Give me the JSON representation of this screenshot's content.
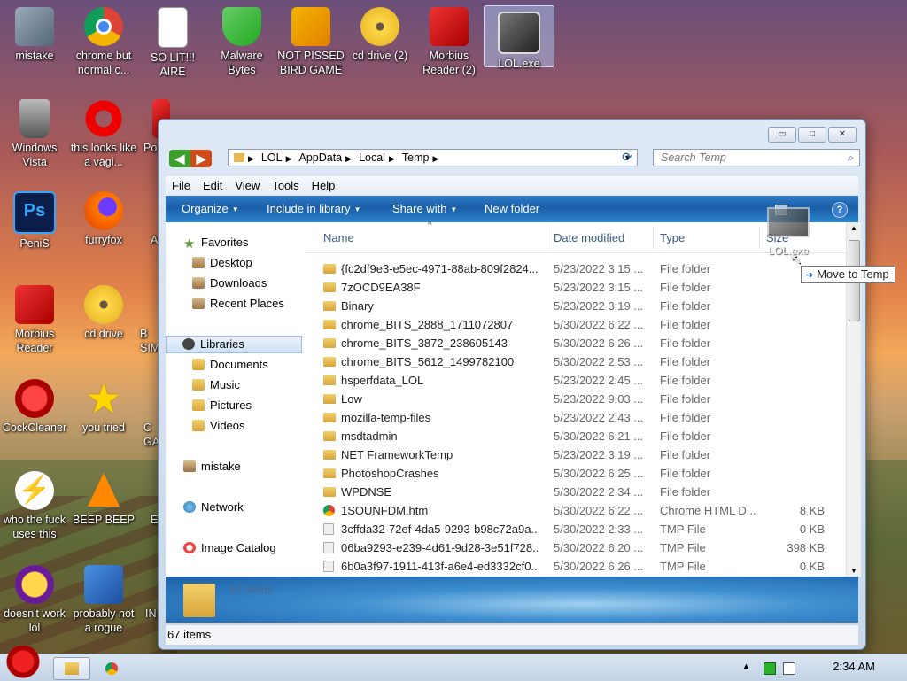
{
  "desktop": {
    "icons": [
      {
        "label": "mistake"
      },
      {
        "label": "chrome but normal c..."
      },
      {
        "label": "SO LIT!!! AIRE"
      },
      {
        "label": "Malware Bytes"
      },
      {
        "label": "NOT PISSED BIRD GAME"
      },
      {
        "label": "cd drive (2)"
      },
      {
        "label": "Morbius Reader (2)"
      },
      {
        "label": "LOL.exe"
      },
      {
        "label": "Windows Vista"
      },
      {
        "label": "this looks like a vagi..."
      },
      {
        "label": "Po"
      },
      {
        "label": "PeniS"
      },
      {
        "label": "furryfox"
      },
      {
        "label": "A"
      },
      {
        "label": "Morbius Reader"
      },
      {
        "label": "cd drive"
      },
      {
        "label": "B SIM"
      },
      {
        "label": "CockCleaner"
      },
      {
        "label": "you tried"
      },
      {
        "label": "C GA"
      },
      {
        "label": "who the fuck uses this"
      },
      {
        "label": "BEEP BEEP"
      },
      {
        "label": "E"
      },
      {
        "label": "doesn't work lol"
      },
      {
        "label": "probably not a rogue"
      },
      {
        "label": "IN"
      }
    ]
  },
  "window": {
    "controls": {
      "minimize": "▭",
      "maximize": "□",
      "close": "✕"
    },
    "nav": {
      "back": "◀",
      "forward": "▶"
    },
    "address": {
      "crumbs": [
        "LOL",
        "AppData",
        "Local",
        "Temp"
      ],
      "sep": "▶",
      "dropdown": "▼"
    },
    "refresh": "⟳",
    "search": {
      "placeholder": "Search Temp",
      "icon": "⌕"
    },
    "menu": [
      "File",
      "Edit",
      "View",
      "Tools",
      "Help"
    ],
    "toolbar": {
      "organize": "Organize",
      "include": "Include in library",
      "share": "Share with",
      "newfolder": "New folder",
      "caret": "▼",
      "help": "?"
    },
    "nav_pane": {
      "favorites": "Favorites",
      "fav_items": [
        "Desktop",
        "Downloads",
        "Recent Places"
      ],
      "libraries": "Libraries",
      "lib_items": [
        "Documents",
        "Music",
        "Pictures",
        "Videos"
      ],
      "user": "mistake",
      "network": "Network",
      "catalog": "Image Catalog"
    },
    "columns": {
      "name": "Name",
      "date": "Date modified",
      "type": "Type",
      "size": "Size",
      "sort": "^"
    },
    "rows": [
      {
        "icon": "folder",
        "name": "{fc2df9e3-e5ec-4971-88ab-809f2824...",
        "date": "5/23/2022 3:15 ...",
        "type": "File folder",
        "size": ""
      },
      {
        "icon": "folder",
        "name": "7zOCD9EA38F",
        "date": "5/23/2022 3:15 ...",
        "type": "File folder",
        "size": ""
      },
      {
        "icon": "folder",
        "name": "Binary",
        "date": "5/23/2022 3:19 ...",
        "type": "File folder",
        "size": ""
      },
      {
        "icon": "folder",
        "name": "chrome_BITS_2888_1711072807",
        "date": "5/30/2022 6:22 ...",
        "type": "File folder",
        "size": ""
      },
      {
        "icon": "folder",
        "name": "chrome_BITS_3872_238605143",
        "date": "5/30/2022 6:26 ...",
        "type": "File folder",
        "size": ""
      },
      {
        "icon": "folder",
        "name": "chrome_BITS_5612_1499782100",
        "date": "5/30/2022 2:53 ...",
        "type": "File folder",
        "size": ""
      },
      {
        "icon": "folder",
        "name": "hsperfdata_LOL",
        "date": "5/23/2022 2:45 ...",
        "type": "File folder",
        "size": ""
      },
      {
        "icon": "folder",
        "name": "Low",
        "date": "5/23/2022 9:03 ...",
        "type": "File folder",
        "size": ""
      },
      {
        "icon": "folder",
        "name": "mozilla-temp-files",
        "date": "5/23/2022 2:43 ...",
        "type": "File folder",
        "size": ""
      },
      {
        "icon": "folder",
        "name": "msdtadmin",
        "date": "5/30/2022 6:21 ...",
        "type": "File folder",
        "size": ""
      },
      {
        "icon": "folder",
        "name": "NET FrameworkTemp",
        "date": "5/23/2022 3:19 ...",
        "type": "File folder",
        "size": ""
      },
      {
        "icon": "folder",
        "name": "PhotoshopCrashes",
        "date": "5/30/2022 6:25 ...",
        "type": "File folder",
        "size": ""
      },
      {
        "icon": "folder",
        "name": "WPDNSE",
        "date": "5/30/2022 2:34 ...",
        "type": "File folder",
        "size": ""
      },
      {
        "icon": "html",
        "name": "1SOUNFDM.htm",
        "date": "5/30/2022 6:22 ...",
        "type": "Chrome HTML D...",
        "size": "8 KB"
      },
      {
        "icon": "file",
        "name": "3cffda32-72ef-4da5-9293-b98c72a9a...",
        "date": "5/30/2022 2:33 ...",
        "type": "TMP File",
        "size": "0 KB"
      },
      {
        "icon": "file",
        "name": "06ba9293-e239-4d61-9d28-3e51f728...",
        "date": "5/30/2022 6:20 ...",
        "type": "TMP File",
        "size": "398 KB"
      },
      {
        "icon": "file",
        "name": "6b0a3f97-1911-413f-a6e4-ed3332cf0...",
        "date": "5/30/2022 6:26 ...",
        "type": "TMP File",
        "size": "0 KB"
      }
    ],
    "details": {
      "count": "67 items"
    },
    "status": {
      "count": "67 items"
    }
  },
  "drag": {
    "ghost_label": "LOL.exe",
    "tooltip": "Move to Temp",
    "arrow": "➜",
    "cursor": "↖"
  },
  "taskbar": {
    "clock": "2:34 AM"
  }
}
